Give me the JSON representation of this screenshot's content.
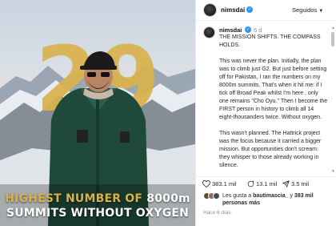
{
  "image": {
    "big_number": "29",
    "headline_line1_highlight": "HIGHEST NUMBER OF",
    "headline_line1_rest": "8000m",
    "headline_line2": "SUMMITS WITHOUT OXYGEN",
    "accent_color": "#d9b24c"
  },
  "header": {
    "username": "nimsdai",
    "follow_label": "Seguidos",
    "verified_color": "#2c97ee"
  },
  "caption": {
    "username": "nimsdai",
    "time": "6 d",
    "paragraphs": [
      "THE MISSION SHIFTS. THE COMPASS HOLDS.",
      "This was never the plan. Initially, the plan was to climb just G2. But just before setting off for Pakistan, I ran the numbers on my 8000m summits. That's when it hit me: if I tick off Broad Peak whilst I'm here , only one remains \"Cho Oyu.\" Then I become the FIRST person in history to climb all 14 eight-thousanders twice. Without oxygen.",
      "This wasn't planned. The Hattrick project was the focus because it carried a bigger mission. But opportunities don't scream: they whisper to those already working in silence."
    ]
  },
  "actions": {
    "likes": "383.1 mil",
    "comments": "13.1 mil",
    "shares": "3.5 mil"
  },
  "likes_summary": {
    "prefix": "Les gusta a",
    "user": "bautimascia_",
    "middle": "y",
    "count": "383 mil personas más"
  },
  "time_ago": "Hace 6 días"
}
